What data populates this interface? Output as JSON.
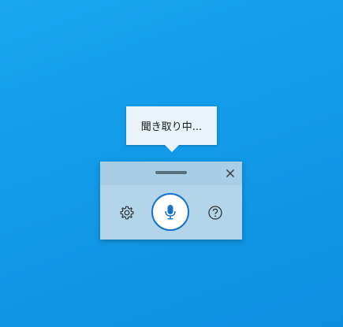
{
  "status": {
    "listening_text": "聞き取り中..."
  },
  "icons": {
    "close": "close-icon",
    "settings": "gear-icon",
    "microphone": "microphone-icon",
    "help": "help-icon"
  },
  "colors": {
    "desktop_background": "#129ae8",
    "panel_background": "#b2d5ea",
    "mic_accent": "#1771c9"
  }
}
